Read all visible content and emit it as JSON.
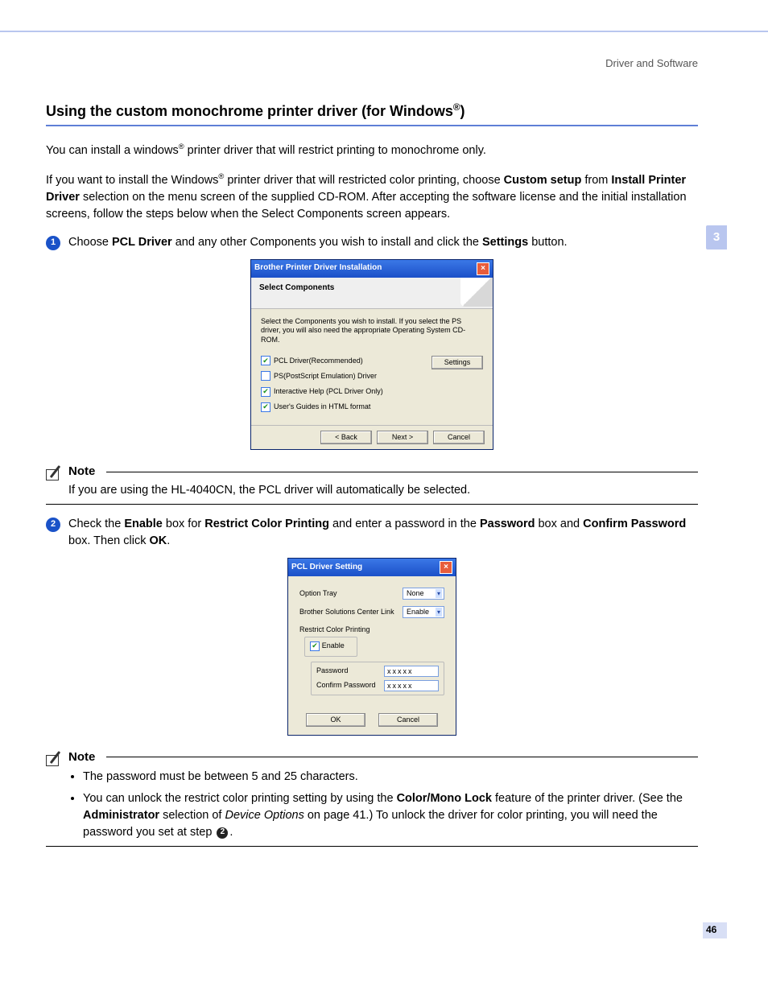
{
  "running_head": "Driver and Software",
  "side_tab": "3",
  "page_number": "46",
  "heading": "Using the custom monochrome printer driver (for Windows",
  "heading_suffix": ")",
  "intro_a": "You can install a windows",
  "intro_b": " printer driver that will restrict printing to monochrome only.",
  "para2_a": "If you want to install the Windows",
  "para2_b": " printer driver that will restricted color printing, choose ",
  "para2_bold1": "Custom setup",
  "para2_c": " from ",
  "para2_bold2": "Install Printer Driver",
  "para2_d": " selection on the menu screen of the supplied CD-ROM. After accepting the software license and the initial installation screens, follow the steps below when the Select Components screen appears.",
  "step1_a": "Choose ",
  "step1_b1": "PCL Driver",
  "step1_b": " and any other Components you wish to install and click the ",
  "step1_b2": "Settings",
  "step1_c": " button.",
  "dialog1": {
    "title": "Brother Printer Driver Installation",
    "head": "Select Components",
    "instr": "Select the Components you wish to install. If you select the PS driver, you will also need the appropriate Operating System CD-ROM.",
    "items": [
      {
        "checked": true,
        "label": "PCL Driver(Recommended)"
      },
      {
        "checked": false,
        "label": "PS(PostScript Emulation) Driver"
      },
      {
        "checked": true,
        "label": "Interactive Help (PCL Driver Only)"
      },
      {
        "checked": true,
        "label": "User's Guides in HTML format"
      }
    ],
    "btn_settings": "Settings",
    "btn_back": "< Back",
    "btn_next": "Next >",
    "btn_cancel": "Cancel"
  },
  "note1_label": "Note",
  "note1_text": "If you are using the HL-4040CN, the PCL driver will automatically be selected.",
  "step2_a": "Check the ",
  "step2_b1": "Enable",
  "step2_b": " box for ",
  "step2_b2": "Restrict Color Printing",
  "step2_c": " and enter a password in the ",
  "step2_b3": "Password",
  "step2_d": " box and ",
  "step2_b4": "Confirm Password",
  "step2_e": " box. Then click ",
  "step2_b5": "OK",
  "step2_f": ".",
  "dialog2": {
    "title": "PCL Driver Setting",
    "row1_label": "Option Tray",
    "row1_value": "None",
    "row2_label": "Brother Solutions Center Link",
    "row2_value": "Enable",
    "group_label": "Restrict Color Printing",
    "enable_label": "Enable",
    "pw_label": "Password",
    "cpw_label": "Confirm Password",
    "pw_mask": "xxxxx",
    "btn_ok": "OK",
    "btn_cancel": "Cancel"
  },
  "note2_label": "Note",
  "note2_item1": "The password must be between 5 and 25 characters.",
  "note2_item2_a": "You can unlock the restrict color printing setting by using the ",
  "note2_item2_b1": "Color/Mono Lock",
  "note2_item2_b": " feature of the printer driver. (See the ",
  "note2_item2_b2": "Administrator",
  "note2_item2_c": " selection of ",
  "note2_item2_i": "Device Options",
  "note2_item2_d": " on page 41.) To unlock the driver for color printing, you will need the password you set at step ",
  "note2_item2_e": "."
}
